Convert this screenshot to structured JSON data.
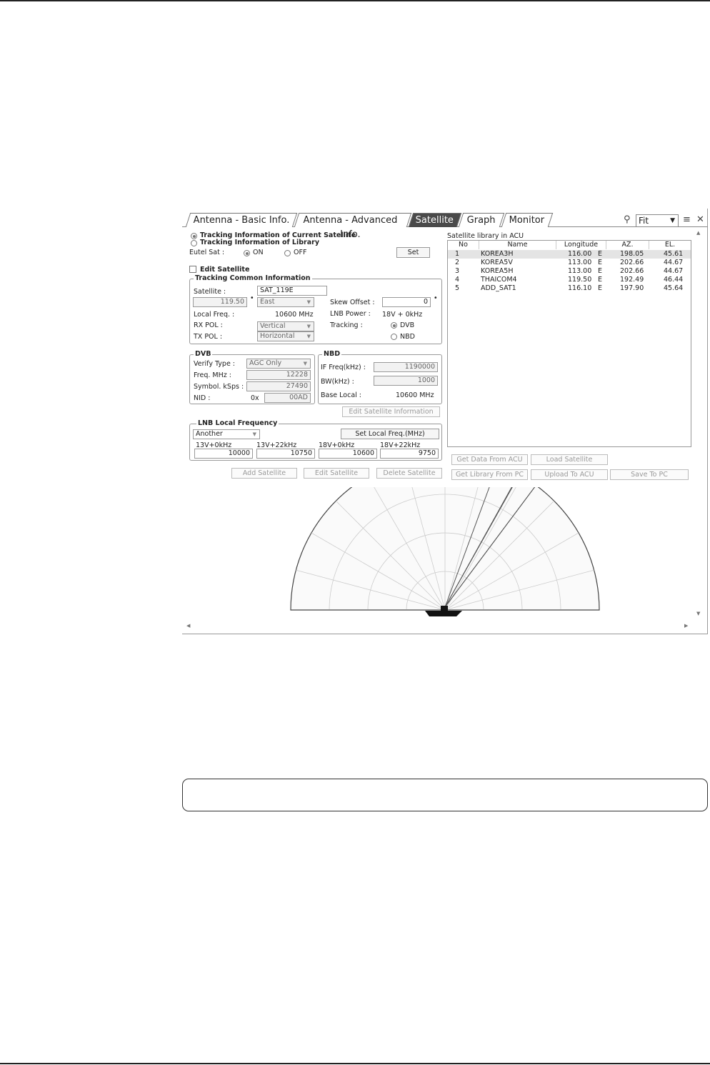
{
  "tabs": [
    {
      "label": "Antenna - Basic Info.",
      "active": false
    },
    {
      "label": "Antenna - Advanced Info.",
      "active": false
    },
    {
      "label": "Satellite",
      "active": true
    },
    {
      "label": "Graph",
      "active": false
    },
    {
      "label": "Monitor",
      "active": false
    }
  ],
  "toolbar": {
    "fit_label": "Fit",
    "pin_icon": "pin-icon",
    "menu_icon": "menu-icon",
    "close_icon": "close-icon"
  },
  "mode": {
    "current_label": "Tracking Information of Current Satellite",
    "library_label": "Tracking Information of Library",
    "selected": "current"
  },
  "eutel": {
    "label": "Eutel Sat :",
    "on_label": "ON",
    "off_label": "OFF",
    "value": "ON",
    "set_label": "Set"
  },
  "edit_satellite_label": "Edit Satellite",
  "tracking_common": {
    "title": "Tracking Common  Information",
    "satellite_label": "Satellite :",
    "satellite_name": "SAT_119E",
    "longitude": "119.50",
    "direction": "East",
    "skew_label": "Skew Offset :",
    "skew_value": "0",
    "local_freq_label": "Local Freq. :",
    "local_freq_value": "10600 MHz",
    "lnb_power_label": "LNB Power :",
    "lnb_power_value": "18V + 0kHz",
    "rx_pol_label": "RX POL :",
    "rx_pol_value": "Vertical",
    "tx_pol_label": "TX POL :",
    "tx_pol_value": "Horizontal",
    "tracking_label": "Tracking :",
    "dvb_label": "DVB",
    "nbd_label": "NBD",
    "tracking_value": "DVB"
  },
  "dvb": {
    "title": "DVB",
    "verify_label": "Verify Type :",
    "verify_value": "AGC Only",
    "freq_label": "Freq. MHz :",
    "freq_value": "12228",
    "symbol_label": "Symbol. kSps :",
    "symbol_value": "27490",
    "nid_label": "NID :",
    "nid_prefix": "0x",
    "nid_value": "00AD"
  },
  "nbd": {
    "title": "NBD",
    "if_label": "IF Freq(kHz) :",
    "if_value": "1190000",
    "bw_label": "BW(kHz) :",
    "bw_value": "1000",
    "base_label": "Base Local :",
    "base_value": "10600 MHz"
  },
  "edit_sat_info_label": "Edit Satellite Information",
  "lnb": {
    "title": "LNB Local Frequency",
    "select_value": "Another",
    "set_label": "Set Local Freq.(MHz)",
    "columns": [
      "13V+0kHz",
      "13V+22kHz",
      "18V+0kHz",
      "18V+22kHz"
    ],
    "values": [
      "10000",
      "10750",
      "10600",
      "9750"
    ]
  },
  "actions": {
    "add": "Add Satellite",
    "edit": "Edit Satellite",
    "delete": "Delete Satellite"
  },
  "library": {
    "title": "Satellite library in ACU",
    "headers": [
      "No",
      "Name",
      "Longitude",
      "AZ.",
      "EL."
    ],
    "rows": [
      {
        "no": "1",
        "name": "KOREA3H",
        "lon": "116.00",
        "dir": "E",
        "az": "198.05",
        "el": "45.61"
      },
      {
        "no": "2",
        "name": "KOREA5V",
        "lon": "113.00",
        "dir": "E",
        "az": "202.66",
        "el": "44.67"
      },
      {
        "no": "3",
        "name": "KOREA5H",
        "lon": "113.00",
        "dir": "E",
        "az": "202.66",
        "el": "44.67"
      },
      {
        "no": "4",
        "name": "THAICOM4",
        "lon": "119.50",
        "dir": "E",
        "az": "192.49",
        "el": "46.44"
      },
      {
        "no": "5",
        "name": "ADD_SAT1",
        "lon": "116.10",
        "dir": "E",
        "az": "197.90",
        "el": "45.64"
      }
    ],
    "selected_row": "1"
  },
  "library_buttons": {
    "get_data": "Get Data From ACU",
    "load": "Load Satellite",
    "get_library": "Get Library From PC",
    "upload": "Upload To ACU",
    "save": "Save To PC"
  },
  "sky_plot": {
    "satellites": [
      {
        "name": "THAICOM4",
        "az": 192.49,
        "el": 46.44
      },
      {
        "name": "ADD_SAT1",
        "az": 197.9,
        "el": 45.64
      },
      {
        "name": "KOREA3H",
        "az": 198.05,
        "el": 45.61
      },
      {
        "name": "KOREA5H",
        "az": 202.66,
        "el": 44.67
      },
      {
        "name": "KOREA5V",
        "az": 202.66,
        "el": 44.67
      }
    ]
  }
}
